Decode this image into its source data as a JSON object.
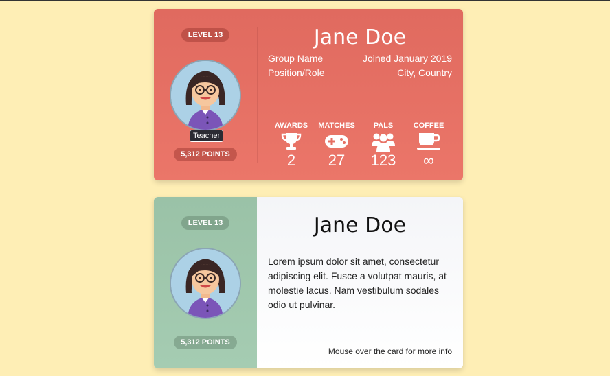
{
  "card1": {
    "level": "LEVEL 13",
    "points": "5,312 POINTS",
    "role_tag": "Teacher",
    "name": "Jane Doe",
    "group": "Group Name",
    "position": "Position/Role",
    "joined": "Joined January 2019",
    "location": "City, Country",
    "stats": [
      {
        "label": "AWARDS",
        "icon": "trophy-icon",
        "value": "2"
      },
      {
        "label": "MATCHES",
        "icon": "gamepad-icon",
        "value": "27"
      },
      {
        "label": "PALS",
        "icon": "users-icon",
        "value": "123"
      },
      {
        "label": "COFFEE",
        "icon": "coffee-icon",
        "value": "∞"
      }
    ],
    "colors": {
      "background": "#e56f63"
    }
  },
  "card2": {
    "level": "LEVEL 13",
    "points": "5,312 POINTS",
    "name": "Jane Doe",
    "bio": "Lorem ipsum dolor sit amet, consectetur adipiscing elit. Fusce a volutpat mauris, at molestie lacus. Nam vestibulum sodales odio ut pulvinar.",
    "hint": "Mouse over the card for more info",
    "colors": {
      "side": "#9fc7ab"
    }
  }
}
